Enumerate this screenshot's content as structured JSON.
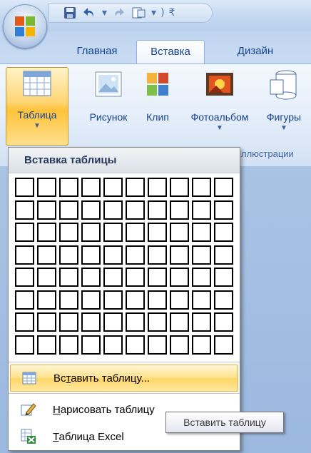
{
  "tabs": [
    {
      "label": "Главная"
    },
    {
      "label": "Вставка"
    },
    {
      "label": "Дизайн"
    }
  ],
  "ribbon": {
    "buttons": [
      {
        "label": "Таблица"
      },
      {
        "label": "Рисунок"
      },
      {
        "label": "Клип"
      },
      {
        "label": "Фотоальбом"
      },
      {
        "label": "Фигуры"
      }
    ],
    "group_label": "ллюстрации"
  },
  "dropdown": {
    "header": "Вставка таблицы",
    "grid": {
      "columns": 10,
      "rows": 8
    },
    "items": [
      {
        "pre": "Вс",
        "acc": "т",
        "post": "авить таблицу..."
      },
      {
        "pre": "",
        "acc": "Н",
        "post": "арисовать таблицу"
      },
      {
        "pre": "",
        "acc": "Т",
        "post": "аблица Excel"
      }
    ]
  },
  "tooltip": "Вставить таблицу",
  "colors": {
    "accent_hover": "#ffd666",
    "ribbon_text": "#15428b"
  }
}
